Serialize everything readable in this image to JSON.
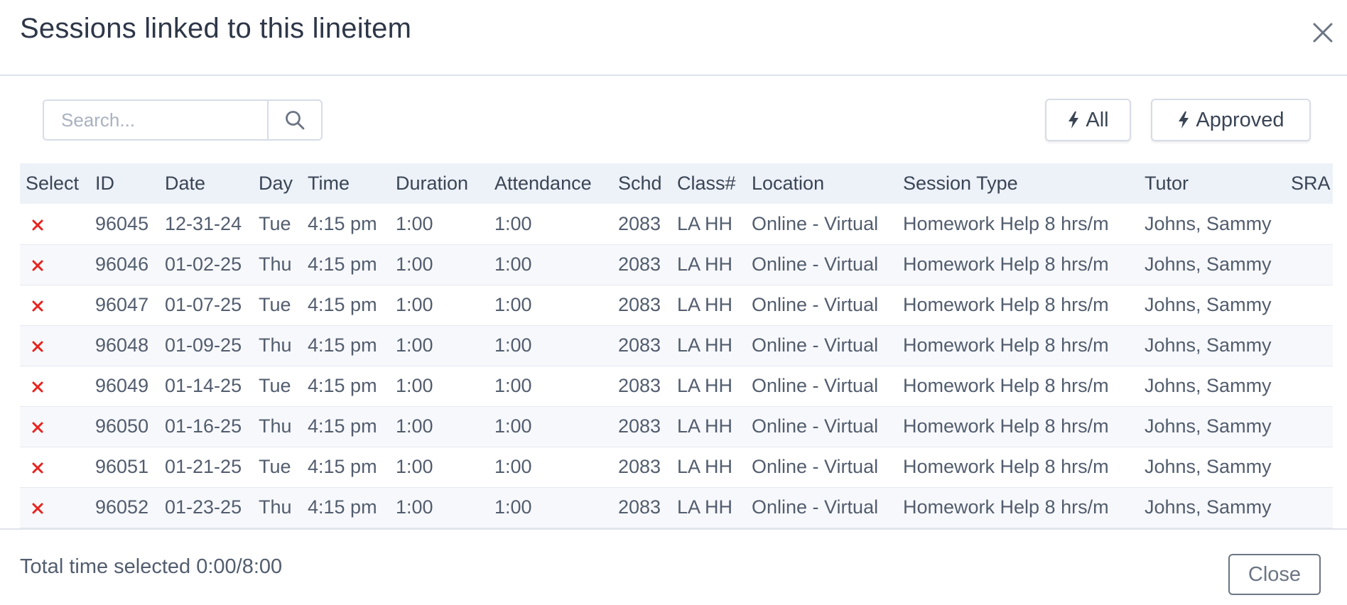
{
  "header": {
    "title": "Sessions linked to this lineitem"
  },
  "toolbar": {
    "search_placeholder": "Search...",
    "filter_all_label": "All",
    "filter_approved_label": "Approved"
  },
  "table": {
    "columns": [
      "Select",
      "ID",
      "Date",
      "Day",
      "Time",
      "Duration",
      "Attendance",
      "Schd",
      "Class#",
      "Location",
      "Session Type",
      "Tutor",
      "SRA"
    ],
    "rows": [
      {
        "id": "96045",
        "date": "12-31-24",
        "day": "Tue",
        "time": "4:15 pm",
        "duration": "1:00",
        "attendance": "1:00",
        "schd": "2083",
        "class": "LA HH",
        "location": "Online - Virtual",
        "session_type": "Homework Help 8 hrs/m",
        "tutor": "Johns, Sammy",
        "sra": ""
      },
      {
        "id": "96046",
        "date": "01-02-25",
        "day": "Thu",
        "time": "4:15 pm",
        "duration": "1:00",
        "attendance": "1:00",
        "schd": "2083",
        "class": "LA HH",
        "location": "Online - Virtual",
        "session_type": "Homework Help 8 hrs/m",
        "tutor": "Johns, Sammy",
        "sra": ""
      },
      {
        "id": "96047",
        "date": "01-07-25",
        "day": "Tue",
        "time": "4:15 pm",
        "duration": "1:00",
        "attendance": "1:00",
        "schd": "2083",
        "class": "LA HH",
        "location": "Online - Virtual",
        "session_type": "Homework Help 8 hrs/m",
        "tutor": "Johns, Sammy",
        "sra": ""
      },
      {
        "id": "96048",
        "date": "01-09-25",
        "day": "Thu",
        "time": "4:15 pm",
        "duration": "1:00",
        "attendance": "1:00",
        "schd": "2083",
        "class": "LA HH",
        "location": "Online - Virtual",
        "session_type": "Homework Help 8 hrs/m",
        "tutor": "Johns, Sammy",
        "sra": ""
      },
      {
        "id": "96049",
        "date": "01-14-25",
        "day": "Tue",
        "time": "4:15 pm",
        "duration": "1:00",
        "attendance": "1:00",
        "schd": "2083",
        "class": "LA HH",
        "location": "Online - Virtual",
        "session_type": "Homework Help 8 hrs/m",
        "tutor": "Johns, Sammy",
        "sra": ""
      },
      {
        "id": "96050",
        "date": "01-16-25",
        "day": "Thu",
        "time": "4:15 pm",
        "duration": "1:00",
        "attendance": "1:00",
        "schd": "2083",
        "class": "LA HH",
        "location": "Online - Virtual",
        "session_type": "Homework Help 8 hrs/m",
        "tutor": "Johns, Sammy",
        "sra": ""
      },
      {
        "id": "96051",
        "date": "01-21-25",
        "day": "Tue",
        "time": "4:15 pm",
        "duration": "1:00",
        "attendance": "1:00",
        "schd": "2083",
        "class": "LA HH",
        "location": "Online - Virtual",
        "session_type": "Homework Help 8 hrs/m",
        "tutor": "Johns, Sammy",
        "sra": ""
      },
      {
        "id": "96052",
        "date": "01-23-25",
        "day": "Thu",
        "time": "4:15 pm",
        "duration": "1:00",
        "attendance": "1:00",
        "schd": "2083",
        "class": "LA HH",
        "location": "Online - Virtual",
        "session_type": "Homework Help 8 hrs/m",
        "tutor": "Johns, Sammy",
        "sra": ""
      }
    ]
  },
  "footer": {
    "total_text": "Total time selected 0:00/8:00",
    "close_label": "Close"
  },
  "icons": {
    "close": "close-icon",
    "search": "search-icon",
    "filter": "lightning-icon",
    "deselect": "x-mark-icon"
  },
  "colors": {
    "title_text": "#2e3748",
    "body_text": "#525d6e",
    "header_row_bg": "#edf1f8",
    "deselect_red": "#e8231f",
    "border": "#d7dce6"
  }
}
